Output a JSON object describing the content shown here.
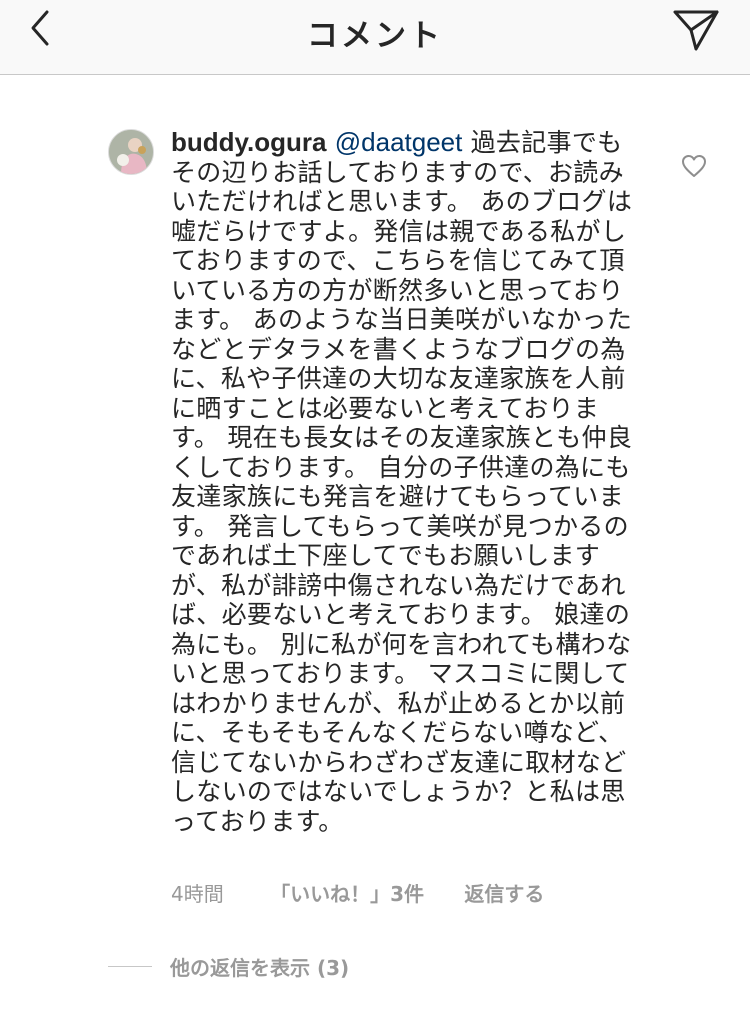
{
  "header": {
    "title": "コメント",
    "back_icon": "chevron-left-icon",
    "send_icon": "paper-plane-icon"
  },
  "comment": {
    "username": "buddy.ogura",
    "mention": "@daatgeet",
    "text": "過去記事でもその辺りお話しておりますので、お読みいただければと思います。 あのブログは嘘だらけですよ。発信は親である私がしておりますので、こちらを信じてみて頂いている方の方が断然多いと思っております。 あのような当日美咲がいなかったなどとデタラメを書くようなブログの為に、私や子供達の大切な友達家族を人前に晒すことは必要ないと考えております。 現在も長女はその友達家族とも仲良くしております。 自分の子供達の為にも友達家族にも発言を避けてもらっています。 発言してもらって美咲が見つかるのであれば土下座してでもお願いしますが、私が誹謗中傷されない為だけであれば、必要ないと考えております。 娘達の為にも。 別に私が何を言われても構わないと思っております。 マスコミに関してはわかりませんが、私が止めるとか以前に、そもそもそんなくだらない噂など、信じてないからわざわざ友達に取材などしないのではないでしょうか？と私は思っております。",
    "time": "4時間",
    "likes": "「いいね！」3件",
    "reply": "返信する",
    "view_replies": "他の返信を表示 (3)",
    "like_icon": "heart-outline-icon",
    "avatar_icon": "avatar"
  }
}
